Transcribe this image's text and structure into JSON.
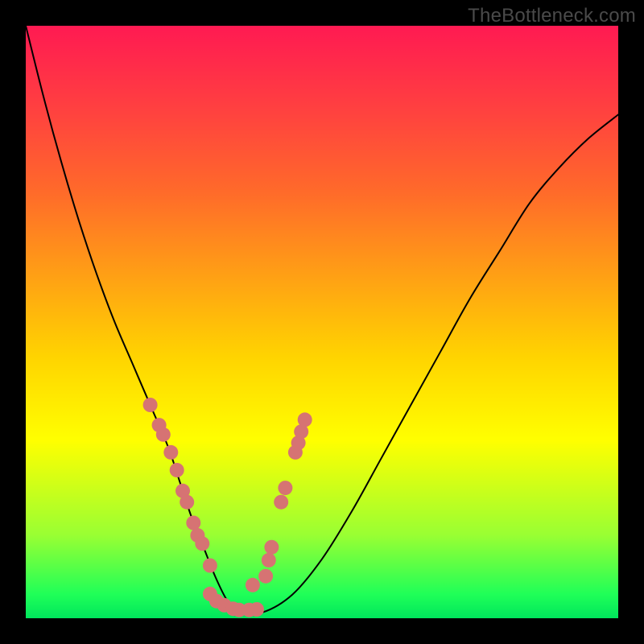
{
  "watermark": "TheBottleneck.com",
  "chart_data": {
    "type": "line",
    "title": "",
    "xlabel": "",
    "ylabel": "",
    "xlim": [
      0,
      100
    ],
    "ylim": [
      0,
      100
    ],
    "grid": false,
    "series": [
      {
        "name": "bottleneck-curve",
        "x": [
          0,
          3,
          6,
          9,
          12,
          15,
          18,
          21,
          24,
          26,
          28,
          30,
          32,
          34,
          36,
          40,
          45,
          50,
          55,
          60,
          65,
          70,
          75,
          80,
          85,
          90,
          95,
          100
        ],
        "y": [
          100,
          88,
          77,
          67,
          58,
          50,
          43,
          36,
          29,
          23,
          17,
          12,
          7,
          3,
          1,
          1,
          4,
          10,
          18,
          27,
          36,
          45,
          54,
          62,
          70,
          76,
          81,
          85
        ]
      }
    ],
    "markers": [
      {
        "x": 21.0,
        "y": 36.0
      },
      {
        "x": 22.5,
        "y": 32.6
      },
      {
        "x": 23.2,
        "y": 31.0
      },
      {
        "x": 24.5,
        "y": 28.0
      },
      {
        "x": 25.5,
        "y": 25.0
      },
      {
        "x": 26.5,
        "y": 21.5
      },
      {
        "x": 27.2,
        "y": 19.6
      },
      {
        "x": 28.3,
        "y": 16.1
      },
      {
        "x": 29.0,
        "y": 14.0
      },
      {
        "x": 29.8,
        "y": 12.6
      },
      {
        "x": 31.1,
        "y": 8.9
      },
      {
        "x": 31.1,
        "y": 4.1
      },
      {
        "x": 32.2,
        "y": 2.9
      },
      {
        "x": 33.5,
        "y": 2.2
      },
      {
        "x": 35.0,
        "y": 1.6
      },
      {
        "x": 36.0,
        "y": 1.4
      },
      {
        "x": 37.7,
        "y": 1.4
      },
      {
        "x": 39.0,
        "y": 1.5
      },
      {
        "x": 38.3,
        "y": 5.6
      },
      {
        "x": 40.5,
        "y": 7.1
      },
      {
        "x": 41.0,
        "y": 9.8
      },
      {
        "x": 41.5,
        "y": 12.0
      },
      {
        "x": 43.1,
        "y": 19.6
      },
      {
        "x": 43.8,
        "y": 22.0
      },
      {
        "x": 45.5,
        "y": 28.0
      },
      {
        "x": 46.0,
        "y": 29.6
      },
      {
        "x": 46.5,
        "y": 31.5
      },
      {
        "x": 47.1,
        "y": 33.5
      }
    ],
    "background_gradient": {
      "top": "#ff1a52",
      "bottom": "#00e65c"
    }
  }
}
